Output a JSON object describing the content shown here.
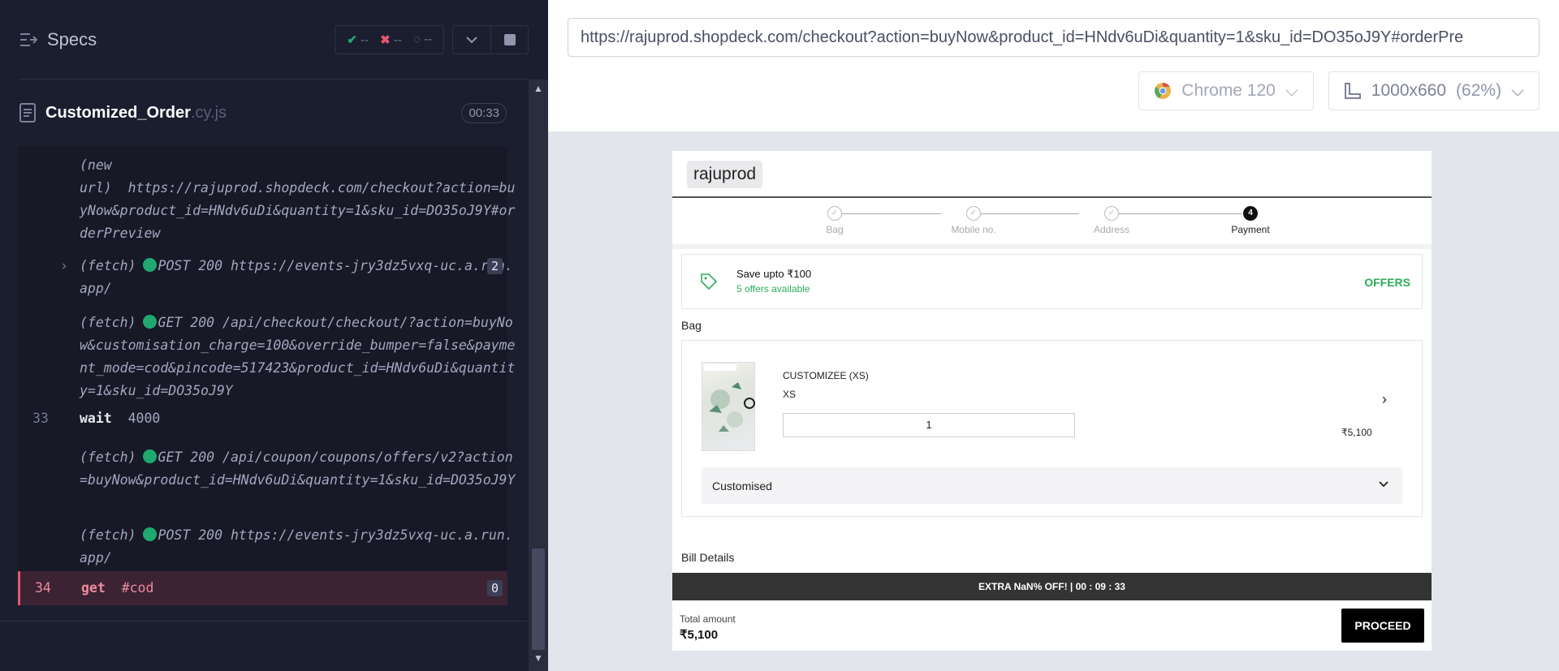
{
  "reporter": {
    "title": "Specs",
    "stats": {
      "passed": "--",
      "failed": "--",
      "pending": "--"
    },
    "spec_file": {
      "name": "Customized_Order",
      "ext": ".cy.js",
      "duration": "00:33"
    },
    "log": [
      {
        "text": "(new\nurl)  https://rajuprod.shopdeck.com/checkout?action=buyNow&product_id=HNdv6uDi&quantity=1&sku_id=DO35oJ9Y#orderPreview"
      },
      {
        "prefix": "(fetch)",
        "text": "POST 200 https://events-jry3dz5vxq-uc.a.run.app/",
        "count": "2"
      },
      {
        "prefix": "(fetch)",
        "text": "GET 200 /api/checkout/checkout/?action=buyNow&customisation_charge=100&override_bumper=false&payment_mode=cod&pincode=517423&product_id=HNdv6uDi&quantity=1&sku_id=DO35oJ9Y"
      },
      {
        "number": "33",
        "command": "wait",
        "arg": "4000"
      },
      {
        "prefix": "(fetch)",
        "text": "GET 200 /api/coupon/coupons/offers/v2?action=buyNow&product_id=HNdv6uDi&quantity=1&sku_id=DO35oJ9Y"
      },
      {
        "prefix": "(fetch)",
        "text": "POST 200 https://events-jry3dz5vxq-uc.a.run.app/"
      },
      {
        "number": "34",
        "command": "get",
        "arg": "#cod",
        "count": "0"
      }
    ]
  },
  "aut": {
    "url": "https://rajuprod.shopdeck.com/checkout?action=buyNow&product_id=HNdv6uDi&quantity=1&sku_id=DO35oJ9Y#orderPre",
    "browser": "Chrome 120",
    "viewport": "1000x660",
    "zoom": "(62%)"
  },
  "app": {
    "brand": "rajuprod",
    "steps": [
      "Bag",
      "Mobile no.",
      "Address",
      "Payment"
    ],
    "active_step_number": "4",
    "offers": {
      "title": "Save upto ₹100",
      "subtitle": "5 offers available",
      "cta": "OFFERS"
    },
    "bag_title": "Bag",
    "product": {
      "name": "CUSTOMIZEE (XS)",
      "size": "XS",
      "quantity": "1",
      "price": "₹5,100"
    },
    "customised_label": "Customised",
    "bill_title": "Bill Details",
    "banner": "EXTRA NaN% OFF! | 00 : 09 : 33",
    "total_label": "Total amount",
    "total_value": "₹5,100",
    "proceed": "PROCEED"
  },
  "colors": {
    "pass": "#1fa971",
    "fail": "#e45770",
    "offer_green": "#2dad5a"
  }
}
